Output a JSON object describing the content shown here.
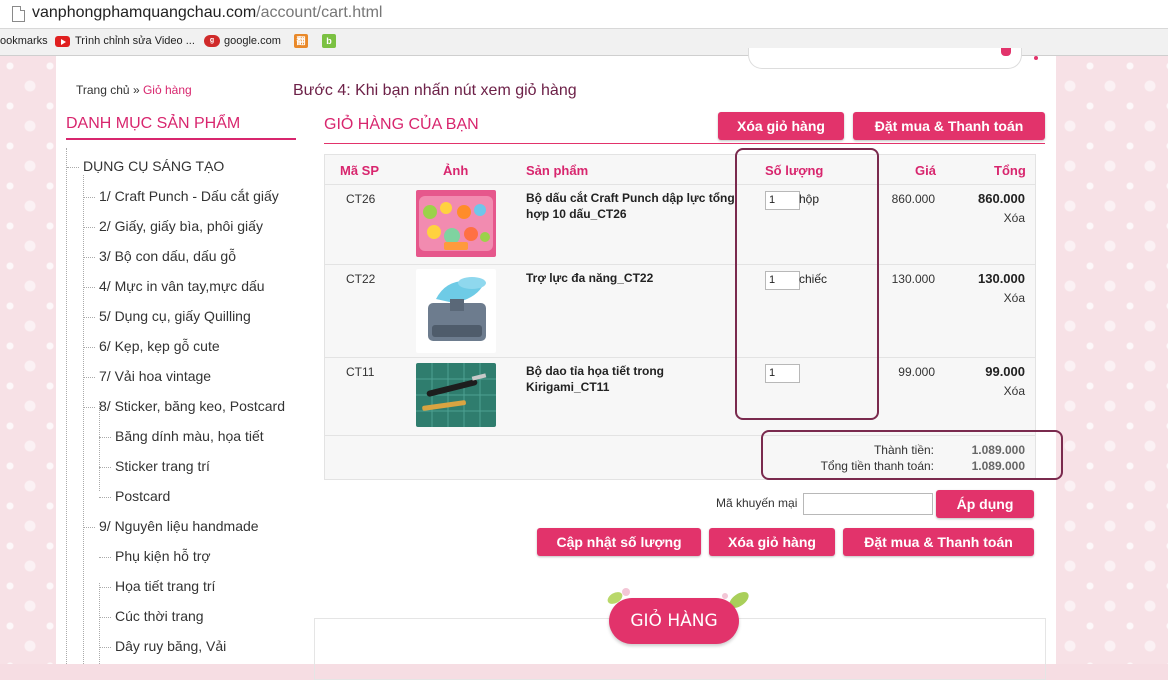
{
  "browser": {
    "url_domain": "vanphongphamquangchau.com",
    "url_path": "/account/cart.html",
    "bookmarks": [
      {
        "label": "ookmarks",
        "icon": "bookmarks-icon"
      },
      {
        "label": "Trình chỉnh sửa Video ...",
        "icon": "youtube-icon"
      },
      {
        "label": "google.com",
        "icon": "google-icon"
      }
    ]
  },
  "breadcrumb": {
    "home": "Trang chủ",
    "sep": "»",
    "current": "Giỏ hàng"
  },
  "instruction": "Bước 4: Khi bạn nhấn nút xem giỏ hàng",
  "sidebar": {
    "title": "DANH MỤC SẢN PHẨM",
    "items": [
      {
        "label": "DỤNG CỤ SÁNG TẠO",
        "level": 0
      },
      {
        "label": "1/ Craft Punch - Dấu cắt giấy",
        "level": 1
      },
      {
        "label": "2/ Giấy, giấy bìa, phôi giấy",
        "level": 1
      },
      {
        "label": "3/ Bộ con dấu, dấu gỗ",
        "level": 1
      },
      {
        "label": "4/ Mực in vân tay,mực dấu",
        "level": 1
      },
      {
        "label": "5/ Dụng cụ, giấy Quilling",
        "level": 1
      },
      {
        "label": "6/ Kẹp, kẹp gỗ cute",
        "level": 1
      },
      {
        "label": "7/ Vải hoa vintage",
        "level": 1
      },
      {
        "label": "8/ Sticker, băng keo, Postcard",
        "level": 1
      },
      {
        "label": "Băng dính màu, họa tiết",
        "level": 2
      },
      {
        "label": "Sticker trang trí",
        "level": 2
      },
      {
        "label": "Postcard",
        "level": 2
      },
      {
        "label": "9/ Nguyên liệu handmade",
        "level": 1
      },
      {
        "label": "Phụ kiện hỗ trợ",
        "level": 2
      },
      {
        "label": "Họa tiết trang trí",
        "level": 2
      },
      {
        "label": "Cúc thời trang",
        "level": 2
      },
      {
        "label": "Dây ruy băng, Vải",
        "level": 2
      }
    ]
  },
  "cart": {
    "title": "GIỎ HÀNG CỦA BẠN",
    "clear_label": "Xóa giỏ hàng",
    "checkout_label": "Đặt mua & Thanh toán",
    "columns": {
      "code": "Mã SP",
      "image": "Ảnh",
      "product": "Sản phẩm",
      "qty": "Số lượng",
      "price": "Giá",
      "total": "Tổng"
    },
    "rows": [
      {
        "code": "CT26",
        "name": "Bộ dấu cắt Craft Punch dập lực tổng hợp 10 dấu_CT26",
        "qty": "1",
        "unit": "hộp",
        "price": "860.000",
        "total": "860.000",
        "delete": "Xóa"
      },
      {
        "code": "CT22",
        "name": "Trợ lực đa năng_CT22",
        "qty": "1",
        "unit": "chiếc",
        "price": "130.000",
        "total": "130.000",
        "delete": "Xóa"
      },
      {
        "code": "CT11",
        "name": "Bộ dao tỉa họa tiết trong Kirigami_CT11",
        "qty": "1",
        "unit": "",
        "price": "99.000",
        "total": "99.000",
        "delete": "Xóa"
      }
    ],
    "subtotal_label": "Thành tiền:",
    "subtotal_value": "1.089.000",
    "grand_label": "Tổng tiền thanh toán:",
    "grand_value": "1.089.000",
    "promo_label": "Mã khuyến mại",
    "promo_value": "",
    "apply_label": "Áp dụng",
    "update_label": "Cập nhật số lượng",
    "badge": "GIỎ HÀNG"
  },
  "colors": {
    "accent": "#e2336b",
    "heading": "#d8266e",
    "annotation": "#7a2a4e"
  }
}
